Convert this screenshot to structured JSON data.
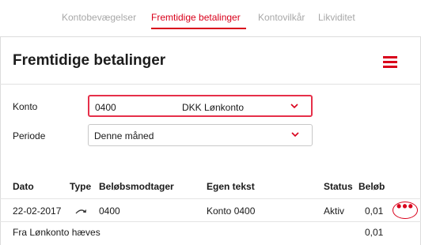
{
  "tabs": [
    {
      "label": "Kontobevægelser",
      "active": false
    },
    {
      "label": "Fremtidige betalinger",
      "active": true
    },
    {
      "label": "Kontovilkår",
      "active": false
    },
    {
      "label": "Likviditet",
      "active": false
    }
  ],
  "page": {
    "title": "Fremtidige betalinger",
    "menu_icon": "hamburger-menu-icon"
  },
  "filters": {
    "account_label": "Konto",
    "account_number": "0400",
    "account_name": "DKK Lønkonto",
    "period_label": "Periode",
    "period_value": "Denne måned"
  },
  "table": {
    "headers": [
      "Dato",
      "Type",
      "Beløbsmodtager",
      "Egen tekst",
      "Status",
      "Beløb"
    ],
    "rows": [
      {
        "date": "22-02-2017",
        "type_icon": "recurring-transfer-icon",
        "recipient": "0400",
        "own_text": "Konto 0400",
        "status": "Aktiv",
        "amount": "0,01",
        "action_icon": "more-options-icon"
      }
    ],
    "summary": {
      "label": "Fra Lønkonto hæves",
      "amount": "0,01"
    }
  },
  "colors": {
    "accent": "#d9001b",
    "inactive_tab": "#a8a8a8",
    "border": "#dcdcdc"
  }
}
